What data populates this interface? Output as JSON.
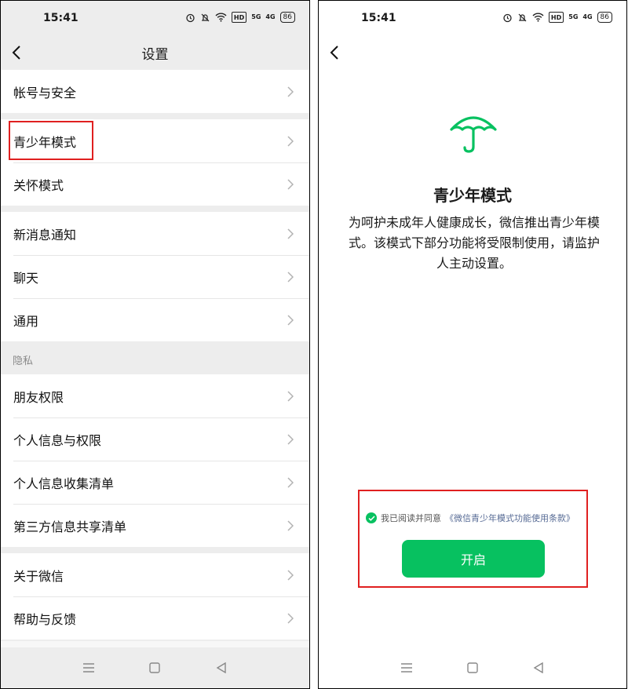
{
  "left": {
    "status": {
      "time": "15:41",
      "hd": "HD",
      "sig1": "5G",
      "sig2": "4G",
      "battery": "86"
    },
    "title": "设置",
    "groups": [
      {
        "items": [
          "帐号与安全"
        ]
      },
      {
        "items": [
          "青少年模式",
          "关怀模式"
        ]
      },
      {
        "items": [
          "新消息通知",
          "聊天",
          "通用"
        ]
      }
    ],
    "privacy_header": "隐私",
    "privacy_items": [
      "朋友权限",
      "个人信息与权限",
      "个人信息收集清单",
      "第三方信息共享清单"
    ],
    "about_items": [
      "关于微信",
      "帮助与反馈"
    ]
  },
  "right": {
    "status": {
      "time": "15:41",
      "hd": "HD",
      "sig1": "5G",
      "sig2": "4G",
      "battery": "86"
    },
    "title": "青少年模式",
    "desc": "为呵护未成年人健康成长，微信推出青少年模式。该模式下部分功能将受限制使用，请监护人主动设置。",
    "agree_prefix": "我已阅读并同意",
    "agree_link": "《微信青少年模式功能使用条款》",
    "start_button": "开启"
  },
  "colors": {
    "accent": "#07c160",
    "highlight": "#e02020",
    "link": "#576b95"
  },
  "icons": [
    "back-arrow-icon",
    "chevron-right-icon",
    "umbrella-icon",
    "check-icon",
    "menu-icon",
    "home-square-icon",
    "back-triangle-icon",
    "alarm-icon",
    "mute-bell-icon",
    "wifi-icon"
  ]
}
